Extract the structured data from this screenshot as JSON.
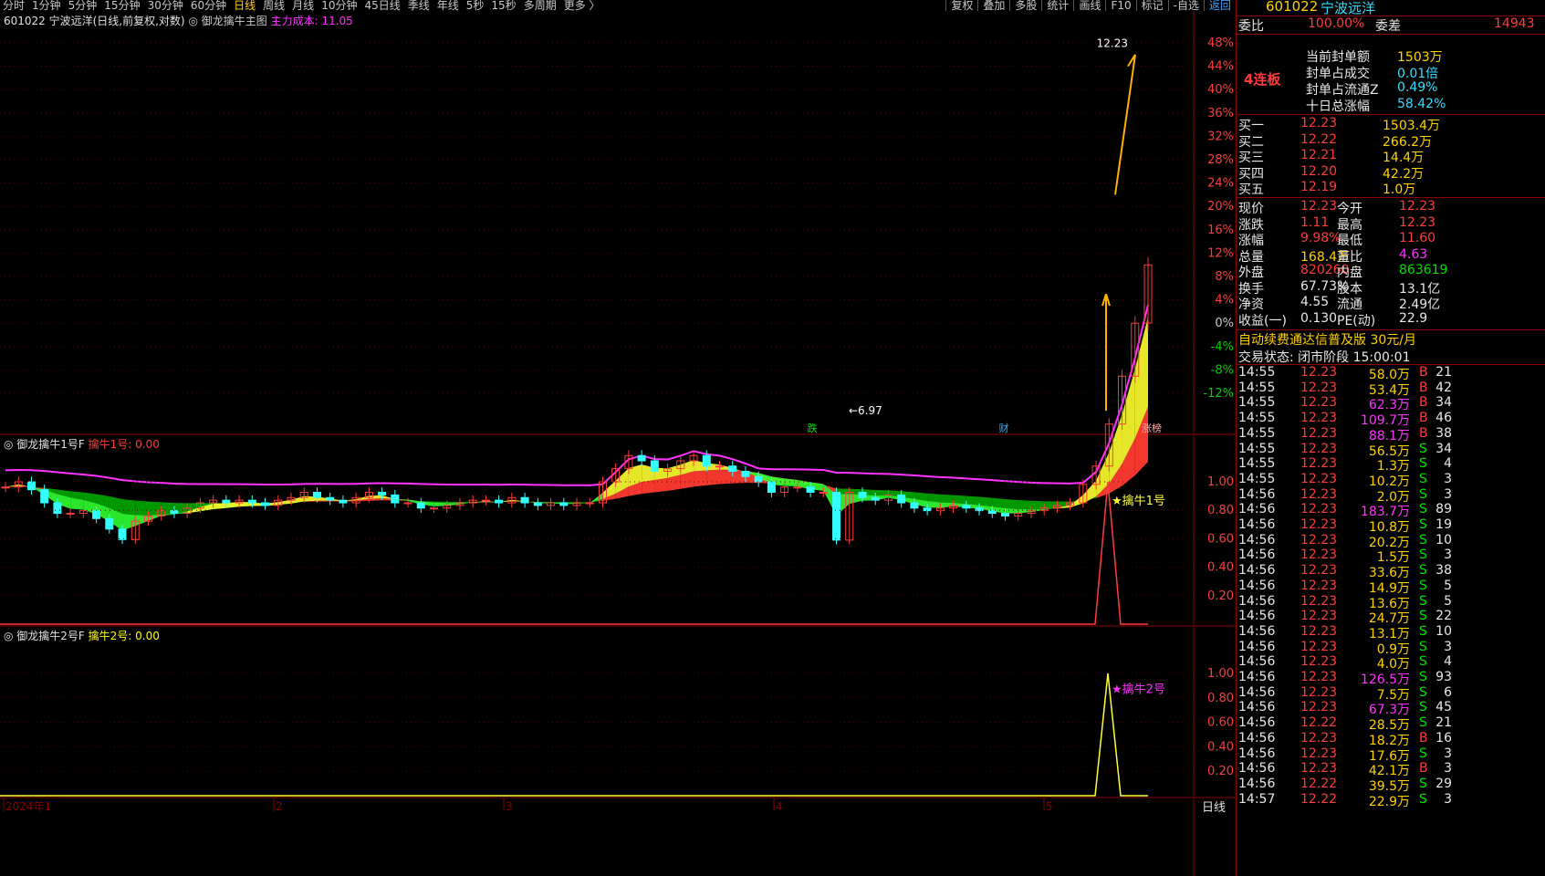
{
  "topbar": {
    "periods": [
      "分时",
      "1分钟",
      "5分钟",
      "15分钟",
      "30分钟",
      "60分钟",
      "日线",
      "周线",
      "月线",
      "10分钟",
      "45日线",
      "季线",
      "年线",
      "5秒",
      "15秒",
      "多周期",
      "更多 〉"
    ],
    "active": "日线",
    "right": [
      "复权",
      "叠加",
      "多股",
      "统计",
      "画线",
      "F10",
      "标记",
      "-自选",
      "返回"
    ]
  },
  "title": {
    "stock": "601022 宁波远洋(日线,前复权,对数)",
    "indicator": "御龙擒牛主图",
    "cost_label": "主力成本: 11.05"
  },
  "panels": {
    "p1_name": "御龙擒牛1号F",
    "p1_value": "擒牛1号: 0.00",
    "p1_mark": "★擒牛1号",
    "p2_name": "御龙擒牛2号F",
    "p2_value": "擒牛2号: 0.00",
    "p2_mark": "★擒牛2号"
  },
  "chart_data": {
    "type": "line",
    "main": {
      "y_axis_pct": [
        "48%",
        "44%",
        "40%",
        "36%",
        "32%",
        "28%",
        "24%",
        "20%",
        "16%",
        "12%",
        "8%",
        "4%",
        "0%",
        "-4%",
        "-8%",
        "-12%"
      ],
      "y_range_pct": [
        -15,
        49
      ],
      "annotations": {
        "high": "12.23",
        "low": "6.97",
        "markers": [
          "跌",
          "财",
          "涨榜"
        ]
      },
      "closes": [
        8.0,
        8.1,
        7.95,
        7.7,
        7.5,
        7.5,
        7.55,
        7.4,
        7.2,
        7.0,
        7.35,
        7.45,
        7.55,
        7.5,
        7.6,
        7.7,
        7.75,
        7.7,
        7.75,
        7.7,
        7.65,
        7.75,
        7.8,
        7.9,
        7.8,
        7.75,
        7.7,
        7.8,
        7.9,
        7.85,
        7.7,
        7.7,
        7.6,
        7.6,
        7.65,
        7.7,
        7.75,
        7.75,
        7.7,
        7.8,
        7.7,
        7.65,
        7.7,
        7.65,
        7.7,
        7.7,
        8.1,
        8.35,
        8.6,
        8.5,
        8.3,
        8.35,
        8.5,
        8.6,
        8.4,
        8.4,
        8.3,
        8.2,
        8.1,
        7.9,
        8.0,
        8.0,
        7.9,
        7.9,
        6.99,
        7.9,
        7.8,
        7.75,
        7.85,
        7.7,
        7.6,
        7.55,
        7.6,
        7.65,
        7.6,
        7.55,
        7.5,
        7.45,
        7.5,
        7.55,
        7.6,
        7.65,
        7.7,
        8.05,
        8.4,
        9.2,
        10.11,
        11.12,
        12.23
      ],
      "x_labels": [
        "2024年1",
        "2",
        "3",
        "4",
        "5"
      ]
    },
    "sub1": {
      "y_axis": [
        "1.00",
        "0.80",
        "0.60",
        "0.40",
        "0.20"
      ],
      "values": [
        0,
        1,
        0
      ]
    },
    "sub2": {
      "y_axis": [
        "1.00",
        "0.80",
        "0.60",
        "0.40",
        "0.20"
      ],
      "values": [
        0,
        1,
        0
      ]
    },
    "period_label": "日线"
  },
  "right_panel": {
    "code": "601022",
    "name": "宁波远洋",
    "weibi_label": "委比",
    "weibi_value": "100.00%",
    "weicha_label": "委差",
    "weicha_value": "14943",
    "board": "4连板",
    "seal": [
      {
        "label": "当前封单额",
        "value": "1503万"
      },
      {
        "label": "封单占成交",
        "value": "0.01倍"
      },
      {
        "label": "封单占流通Z",
        "value": "0.49%"
      },
      {
        "label": "十日总涨幅",
        "value": "58.42%"
      }
    ],
    "bids": [
      {
        "label": "买一",
        "price": "12.23",
        "vol": "1503.4万"
      },
      {
        "label": "买二",
        "price": "12.22",
        "vol": "266.2万"
      },
      {
        "label": "买三",
        "price": "12.21",
        "vol": "14.4万"
      },
      {
        "label": "买四",
        "price": "12.20",
        "vol": "42.2万"
      },
      {
        "label": "买五",
        "price": "12.19",
        "vol": "1.0万"
      }
    ],
    "quote": [
      {
        "l1": "现价",
        "v1": "12.23",
        "l2": "今开",
        "v2": "12.23"
      },
      {
        "l1": "涨跌",
        "v1": "1.11",
        "l2": "最高",
        "v2": "12.23"
      },
      {
        "l1": "涨幅",
        "v1": "9.98%",
        "l2": "最低",
        "v2": "11.60"
      },
      {
        "l1": "总量",
        "v1": "168.4万",
        "l2": "量比",
        "v2": "4.63"
      },
      {
        "l1": "外盘",
        "v1": "820260",
        "l2": "内盘",
        "v2": "863619"
      },
      {
        "l1": "换手",
        "v1": "67.73%",
        "l2": "股本",
        "v2": "13.1亿"
      },
      {
        "l1": "净资",
        "v1": "4.55",
        "l2": "流通",
        "v2": "2.49亿"
      },
      {
        "l1": "收益(一)",
        "v1": "0.130",
        "l2": "PE(动)",
        "v2": "22.9"
      }
    ],
    "promo": "自动续费通达信普及版 30元/月",
    "status": "交易状态: 闭市阶段 15:00:01",
    "ticks": [
      [
        "14:55",
        "12.23",
        "58.0万",
        "B",
        "21"
      ],
      [
        "14:55",
        "12.23",
        "53.4万",
        "B",
        "42"
      ],
      [
        "14:55",
        "12.23",
        "62.3万",
        "B",
        "34"
      ],
      [
        "14:55",
        "12.23",
        "109.7万",
        "B",
        "46"
      ],
      [
        "14:55",
        "12.23",
        "88.1万",
        "B",
        "38"
      ],
      [
        "14:55",
        "12.23",
        "56.5万",
        "S",
        "34"
      ],
      [
        "14:55",
        "12.23",
        "1.3万",
        "S",
        "4"
      ],
      [
        "14:55",
        "12.23",
        "10.2万",
        "S",
        "3"
      ],
      [
        "14:56",
        "12.23",
        "2.0万",
        "S",
        "3"
      ],
      [
        "14:56",
        "12.23",
        "183.7万",
        "S",
        "89"
      ],
      [
        "14:56",
        "12.23",
        "10.8万",
        "S",
        "19"
      ],
      [
        "14:56",
        "12.23",
        "20.2万",
        "S",
        "10"
      ],
      [
        "14:56",
        "12.23",
        "1.5万",
        "S",
        "3"
      ],
      [
        "14:56",
        "12.23",
        "33.6万",
        "S",
        "38"
      ],
      [
        "14:56",
        "12.23",
        "14.9万",
        "S",
        "5"
      ],
      [
        "14:56",
        "12.23",
        "13.6万",
        "S",
        "5"
      ],
      [
        "14:56",
        "12.23",
        "24.7万",
        "S",
        "22"
      ],
      [
        "14:56",
        "12.23",
        "13.1万",
        "S",
        "10"
      ],
      [
        "14:56",
        "12.23",
        "0.9万",
        "S",
        "3"
      ],
      [
        "14:56",
        "12.23",
        "4.0万",
        "S",
        "4"
      ],
      [
        "14:56",
        "12.23",
        "126.5万",
        "S",
        "93"
      ],
      [
        "14:56",
        "12.23",
        "7.5万",
        "S",
        "6"
      ],
      [
        "14:56",
        "12.23",
        "67.3万",
        "S",
        "45"
      ],
      [
        "14:56",
        "12.22",
        "28.5万",
        "S",
        "21"
      ],
      [
        "14:56",
        "12.23",
        "18.2万",
        "B",
        "16"
      ],
      [
        "14:56",
        "12.23",
        "17.6万",
        "S",
        "3"
      ],
      [
        "14:56",
        "12.23",
        "42.1万",
        "B",
        "3"
      ],
      [
        "14:56",
        "12.22",
        "39.5万",
        "S",
        "29"
      ],
      [
        "14:57",
        "12.22",
        "22.9万",
        "S",
        "3"
      ]
    ]
  }
}
